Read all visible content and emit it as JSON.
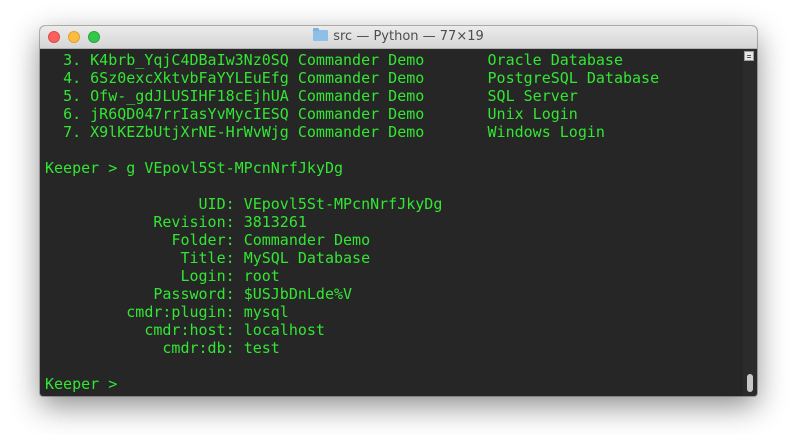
{
  "window": {
    "title": "src — Python — 77×19",
    "folder_icon": "folder-icon"
  },
  "terminal": {
    "records": [
      {
        "num": "3.",
        "uid": "K4brb_YqjC4DBaIw3Nz0SQ",
        "folder": "Commander Demo",
        "title": "Oracle Database"
      },
      {
        "num": "4.",
        "uid": "6Sz0excXktvbFaYYLEuEfg",
        "folder": "Commander Demo",
        "title": "PostgreSQL Database"
      },
      {
        "num": "5.",
        "uid": "Ofw-_gdJLUSIHF18cEjhUA",
        "folder": "Commander Demo",
        "title": "SQL Server"
      },
      {
        "num": "6.",
        "uid": "jR6QD047rrIasYvMycIESQ",
        "folder": "Commander Demo",
        "title": "Unix Login"
      },
      {
        "num": "7.",
        "uid": "X9lKEZbUtjXrNE-HrWvWjg",
        "folder": "Commander Demo",
        "title": "Windows Login"
      }
    ],
    "command_line": "Keeper > g VEpovl5St-MPcnNrfJkyDg",
    "details": [
      {
        "label": "UID:",
        "value": "VEpovl5St-MPcnNrfJkyDg"
      },
      {
        "label": "Revision:",
        "value": "3813261"
      },
      {
        "label": "Folder:",
        "value": "Commander Demo"
      },
      {
        "label": "Title:",
        "value": "MySQL Database"
      },
      {
        "label": "Login:",
        "value": "root"
      },
      {
        "label": "Password:",
        "value": "$USJbDnLde%V"
      },
      {
        "label": "cmdr:plugin:",
        "value": "mysql"
      },
      {
        "label": "cmdr:host:",
        "value": "localhost"
      },
      {
        "label": "cmdr:db:",
        "value": "test"
      }
    ],
    "prompt": "Keeper > ",
    "text_color": "#33e633",
    "background_color": "#262626"
  }
}
